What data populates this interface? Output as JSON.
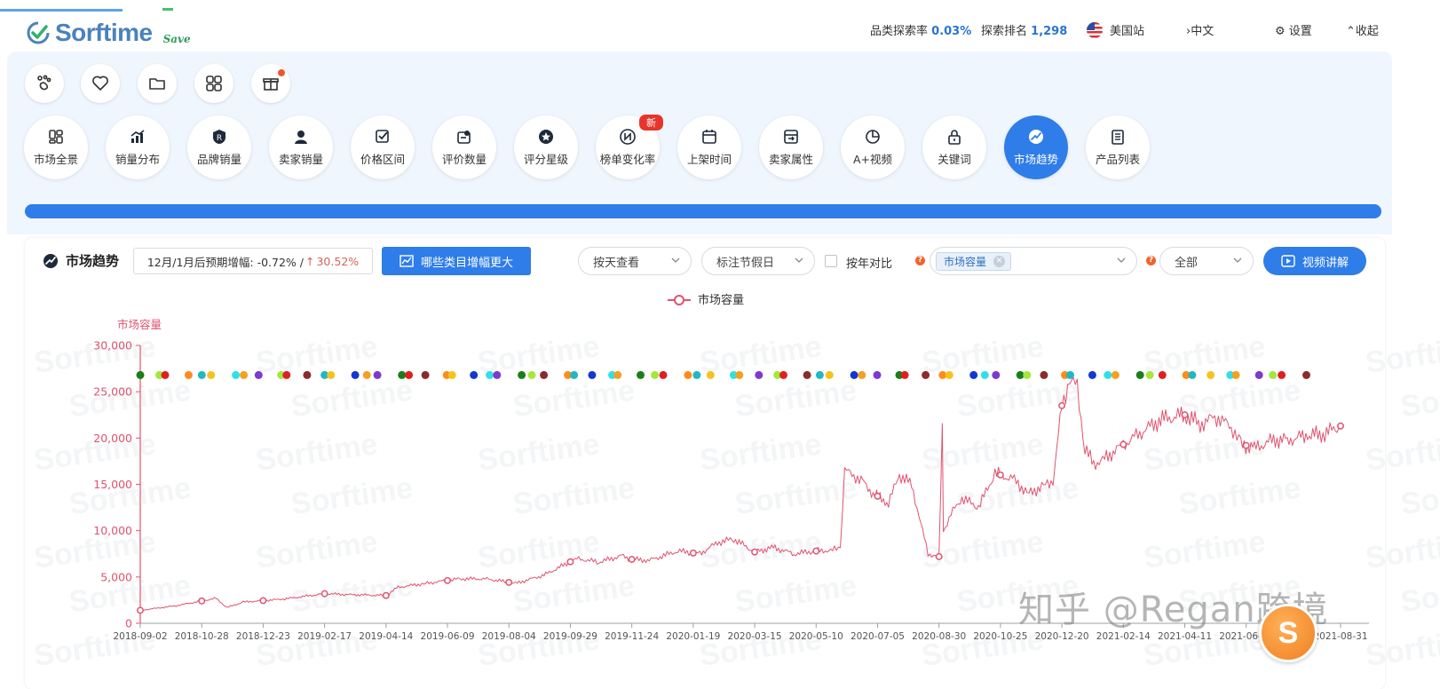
{
  "topbar": {
    "brand": "Sorftime",
    "brand_sub": "Save",
    "explore_rate_label": "品类探索率",
    "explore_rate_value": "0.03%",
    "explore_rank_label": "探索排名",
    "explore_rank_value": "1,298",
    "site": "美国站",
    "language": "中文",
    "settings": "设置",
    "collapse": "收起"
  },
  "colors": {
    "accent": "#2f7de8",
    "series": "#e0536f",
    "badge": "#e8352b"
  },
  "quick_icons": [
    "footprint-icon",
    "heart-icon",
    "folder-icon",
    "grid-icon",
    "gift-icon"
  ],
  "tabs": [
    {
      "label": "市场全景",
      "icon": "panorama-icon"
    },
    {
      "label": "销量分布",
      "icon": "bar-chart-icon"
    },
    {
      "label": "品牌销量",
      "icon": "brand-icon"
    },
    {
      "label": "卖家销量",
      "icon": "seller-icon"
    },
    {
      "label": "价格区间",
      "icon": "price-icon"
    },
    {
      "label": "评价数量",
      "icon": "review-icon"
    },
    {
      "label": "评分星级",
      "icon": "star-icon"
    },
    {
      "label": "榜单变化率",
      "icon": "rank-change-icon",
      "badge": "新"
    },
    {
      "label": "上架时间",
      "icon": "calendar-icon"
    },
    {
      "label": "卖家属性",
      "icon": "seller-attr-icon"
    },
    {
      "label": "A+视频",
      "icon": "pie-icon"
    },
    {
      "label": "关键词",
      "icon": "lock-icon"
    },
    {
      "label": "市场趋势",
      "icon": "trend-icon",
      "active": true
    },
    {
      "label": "产品列表",
      "icon": "list-icon"
    }
  ],
  "controls": {
    "section_title": "市场趋势",
    "forecast_text": "12月/1月后预期增幅: -0.72% /",
    "forecast_up": "30.52%",
    "growth_button": "哪些类目增幅更大",
    "view_select": "按天查看",
    "holiday_select": "标注节假日",
    "yoy_label": "按年对比",
    "metric_tag": "市场容量",
    "range_select": "全部",
    "video_button": "视频讲解"
  },
  "watermark": "Sorftime",
  "overlay_text": "知乎 @Regan跨境",
  "chart_data": {
    "type": "line",
    "legend": [
      "市场容量"
    ],
    "ylabel": "市场容量",
    "ylim": [
      0,
      30000
    ],
    "yticks": [
      "0",
      "5,000",
      "10,000",
      "15,000",
      "20,000",
      "25,000",
      "30,000"
    ],
    "xticks": [
      "2018-09-02",
      "2018-10-28",
      "2018-12-23",
      "2019-02-17",
      "2019-04-14",
      "2019-06-09",
      "2019-08-04",
      "2019-09-29",
      "2019-11-24",
      "2020-01-19",
      "2020-03-15",
      "2020-05-10",
      "2020-07-05",
      "2020-08-30",
      "2020-10-25",
      "2020-12-20",
      "2021-02-14",
      "2021-04-11",
      "2021-06-06",
      "2021-08-31"
    ],
    "series": [
      {
        "name": "市场容量",
        "x": [
          "2018-09-02",
          "2018-10-05",
          "2018-11-10",
          "2018-11-20",
          "2018-12-05",
          "2019-01-10",
          "2019-02-17",
          "2019-03-10",
          "2019-04-14",
          "2019-04-25",
          "2019-05-20",
          "2019-06-20",
          "2019-07-15",
          "2019-08-10",
          "2019-09-05",
          "2019-10-05",
          "2019-10-25",
          "2019-11-15",
          "2019-11-24",
          "2019-12-10",
          "2020-01-05",
          "2020-01-25",
          "2020-02-10",
          "2020-02-25",
          "2020-03-15",
          "2020-04-01",
          "2020-04-20",
          "2020-05-10",
          "2020-05-25",
          "2020-06-01",
          "2020-06-05",
          "2020-06-20",
          "2020-07-01",
          "2020-07-15",
          "2020-07-25",
          "2020-08-05",
          "2020-08-20",
          "2020-08-30",
          "2020-09-02",
          "2020-09-03",
          "2020-09-10",
          "2020-09-20",
          "2020-10-05",
          "2020-10-20",
          "2020-11-05",
          "2020-11-20",
          "2020-12-05",
          "2020-12-12",
          "2020-12-20",
          "2020-12-27",
          "2021-01-03",
          "2021-01-10",
          "2021-01-18",
          "2021-01-28",
          "2021-02-14",
          "2021-03-01",
          "2021-03-20",
          "2021-04-11",
          "2021-04-25",
          "2021-05-10",
          "2021-05-25",
          "2021-06-01",
          "2021-06-15",
          "2021-07-01",
          "2021-07-15",
          "2021-08-01",
          "2021-08-15",
          "2021-08-31"
        ],
        "y": [
          1400,
          1900,
          2700,
          1700,
          2300,
          2600,
          3200,
          3100,
          3000,
          3900,
          4300,
          4800,
          4800,
          4300,
          5200,
          7000,
          6600,
          7300,
          6900,
          6800,
          7800,
          7500,
          8700,
          9100,
          7700,
          8200,
          7500,
          7800,
          7900,
          8200,
          16500,
          15500,
          14000,
          13000,
          16000,
          15000,
          7500,
          7200,
          21000,
          10000,
          11800,
          13500,
          12500,
          16200,
          15600,
          14000,
          15000,
          15300,
          23500,
          26200,
          25500,
          18800,
          17200,
          17800,
          19300,
          20500,
          22000,
          22500,
          21500,
          22300,
          21000,
          19300,
          19000,
          19800,
          19800,
          20300,
          20400,
          21300
        ]
      }
    ],
    "holiday_dots_y": 26800
  }
}
